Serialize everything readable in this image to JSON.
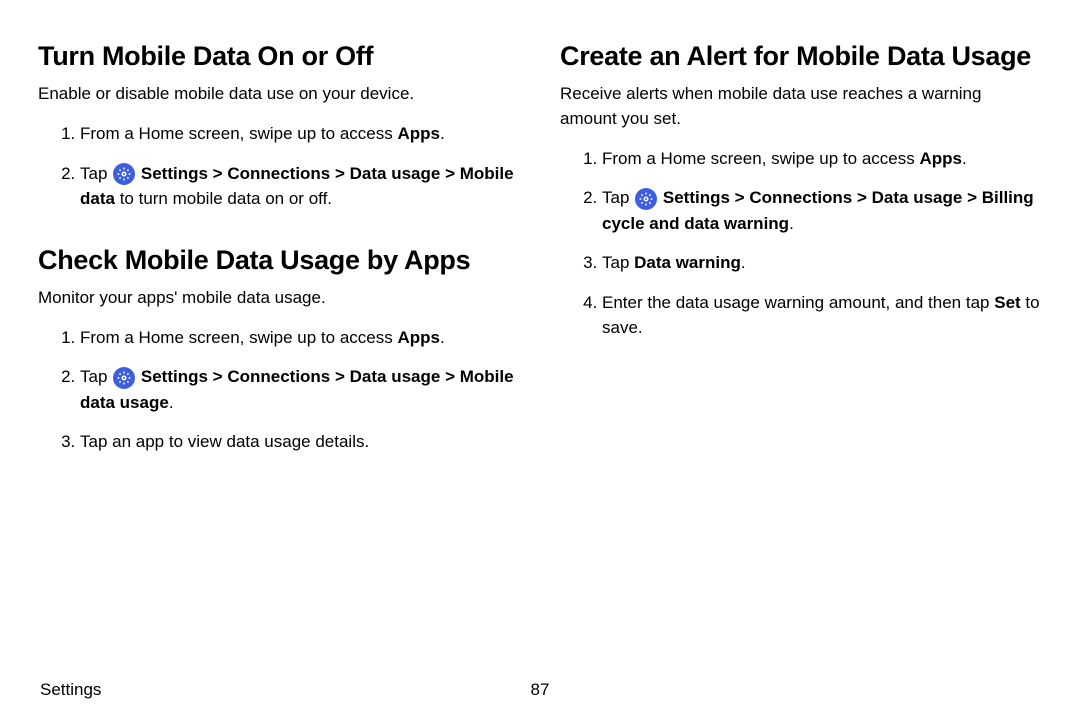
{
  "left": {
    "section1": {
      "title": "Turn Mobile Data On or Off",
      "desc": "Enable or disable mobile data use on your device.",
      "step1_a": "From a Home screen, swipe up to access ",
      "step1_b": "Apps",
      "step1_c": ".",
      "step2_a": "Tap ",
      "step2_b": "Settings",
      "step2_c": " > ",
      "step2_d": "Connections",
      "step2_e": " > ",
      "step2_f": "Data usage",
      "step2_g": " > ",
      "step2_h": "Mobile data",
      "step2_i": " to turn mobile data on or off."
    },
    "section2": {
      "title": "Check Mobile Data Usage by Apps",
      "desc": "Monitor your apps' mobile data usage.",
      "step1_a": "From a Home screen, swipe up to access ",
      "step1_b": "Apps",
      "step1_c": ".",
      "step2_a": "Tap ",
      "step2_b": "Settings",
      "step2_c": " > ",
      "step2_d": "Connections",
      "step2_e": " > ",
      "step2_f": "Data usage",
      "step2_g": " > ",
      "step2_h": "Mobile data usage",
      "step2_i": ".",
      "step3": "Tap an app to view data usage details."
    }
  },
  "right": {
    "section1": {
      "title": "Create an Alert for Mobile Data Usage",
      "desc": "Receive alerts when mobile data use reaches a warning amount you set.",
      "step1_a": "From a Home screen, swipe up to access ",
      "step1_b": "Apps",
      "step1_c": ".",
      "step2_a": "Tap ",
      "step2_b": "Settings",
      "step2_c": " > ",
      "step2_d": "Connections",
      "step2_e": " > ",
      "step2_f": "Data usage",
      "step2_g": " > ",
      "step2_h": "Billing cycle and data warning",
      "step2_i": ".",
      "step3_a": "Tap ",
      "step3_b": "Data warning",
      "step3_c": ".",
      "step4_a": "Enter the data usage warning amount, and then tap ",
      "step4_b": "Set",
      "step4_c": " to save."
    }
  },
  "footer": {
    "label": "Settings",
    "page": "87"
  }
}
